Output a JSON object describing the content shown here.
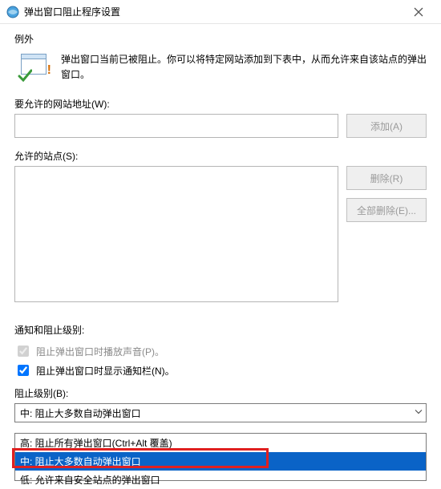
{
  "titlebar": {
    "title": "弹出窗口阻止程序设置"
  },
  "intro": {
    "heading": "例外",
    "text": "弹出窗口当前已被阻止。你可以将特定网站添加到下表中，从而允许来自该站点的弹出窗口。"
  },
  "address": {
    "label": "要允许的网站地址(W):",
    "value": "",
    "add_button": "添加(A)"
  },
  "allowed": {
    "label": "允许的站点(S):",
    "remove_button": "删除(R)",
    "remove_all_button": "全部删除(E)..."
  },
  "notify": {
    "heading": "通知和阻止级别:",
    "play_sound": "阻止弹出窗口时播放声音(P)。",
    "play_sound_checked": true,
    "show_bar": "阻止弹出窗口时显示通知栏(N)。",
    "show_bar_checked": true
  },
  "level": {
    "label": "阻止级别(B):",
    "current": "中: 阻止大多数自动弹出窗口",
    "options": [
      "高: 阻止所有弹出窗口(Ctrl+Alt 覆盖)",
      "中: 阻止大多数自动弹出窗口",
      "低: 允许来自安全站点的弹出窗口"
    ],
    "selected_index": 1
  }
}
